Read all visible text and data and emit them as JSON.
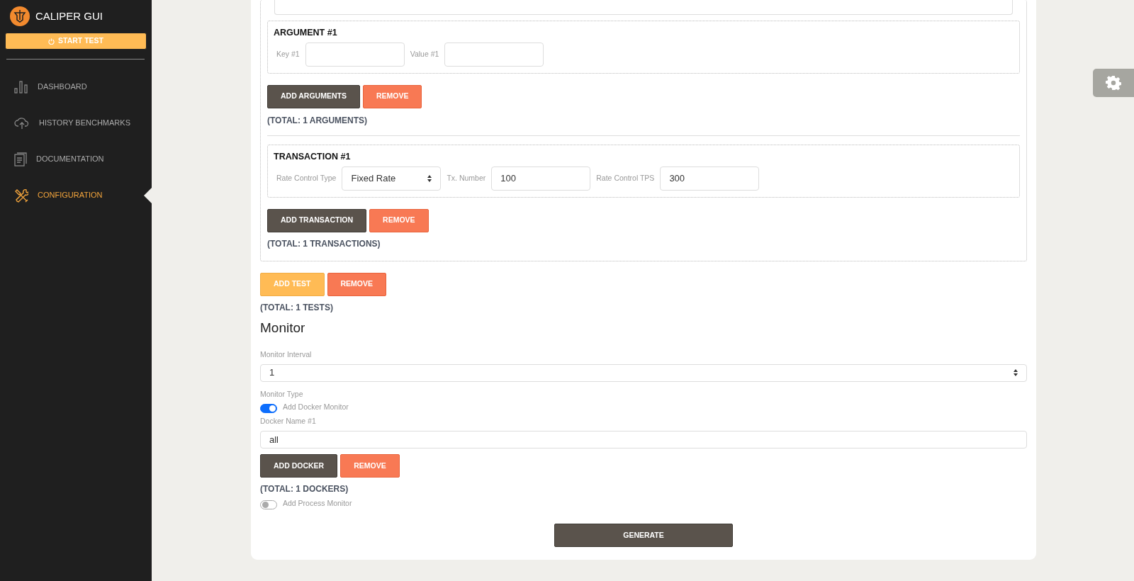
{
  "sidebar": {
    "brand": "CALIPER GUI",
    "start_button": "START TEST",
    "items": [
      {
        "label": "DASHBOARD",
        "selected": false
      },
      {
        "label": "HISTORY BENCHMARKS",
        "selected": false
      },
      {
        "label": "DOCUMENTATION",
        "selected": false
      },
      {
        "label": "CONFIGURATION",
        "selected": true
      }
    ]
  },
  "test": {
    "arguments": [
      {
        "title": "ARGUMENT #1",
        "fields": [
          {
            "label": "Key #1",
            "kind": "input"
          },
          {
            "label": "Value #1",
            "kind": "input"
          }
        ]
      }
    ],
    "argument_buttons": [
      "ADD ARGUMENTS",
      "REMOVE"
    ],
    "argument_total": "(TOTAL: 1 ARGUMENTS)",
    "transactions": [
      {
        "title": "TRANSACTION #1",
        "fields": [
          {
            "label": "Rate Control Type",
            "kind": "select",
            "value": "Fixed Rate"
          },
          {
            "label": "Tx. Number",
            "kind": "input",
            "value": "100"
          },
          {
            "label": "Rate Control TPS",
            "kind": "input",
            "value": "300"
          }
        ]
      }
    ],
    "transaction_buttons": [
      "ADD TRANSACTION",
      "REMOVE"
    ],
    "transaction_total": "(TOTAL: 1 TRANSACTIONS)"
  },
  "test_buttons": [
    "ADD TEST",
    "REMOVE"
  ],
  "test_total": "(TOTAL: 1 TESTS)",
  "monitor": {
    "heading": "Monitor",
    "interval_label": "Monitor Interval",
    "interval_value": "1",
    "type_label": "Monitor Type",
    "docker_toggle": {
      "label": "Add Docker Monitor",
      "on": true
    },
    "docker_name_label": "Docker Name #1",
    "docker_name_value": "all",
    "docker_buttons": [
      "ADD DOCKER",
      "REMOVE"
    ],
    "docker_total": "(TOTAL: 1 DOCKERS)",
    "process_toggle": {
      "label": "Add Process Monitor",
      "on": false
    }
  },
  "generate_button": "GENERATE"
}
